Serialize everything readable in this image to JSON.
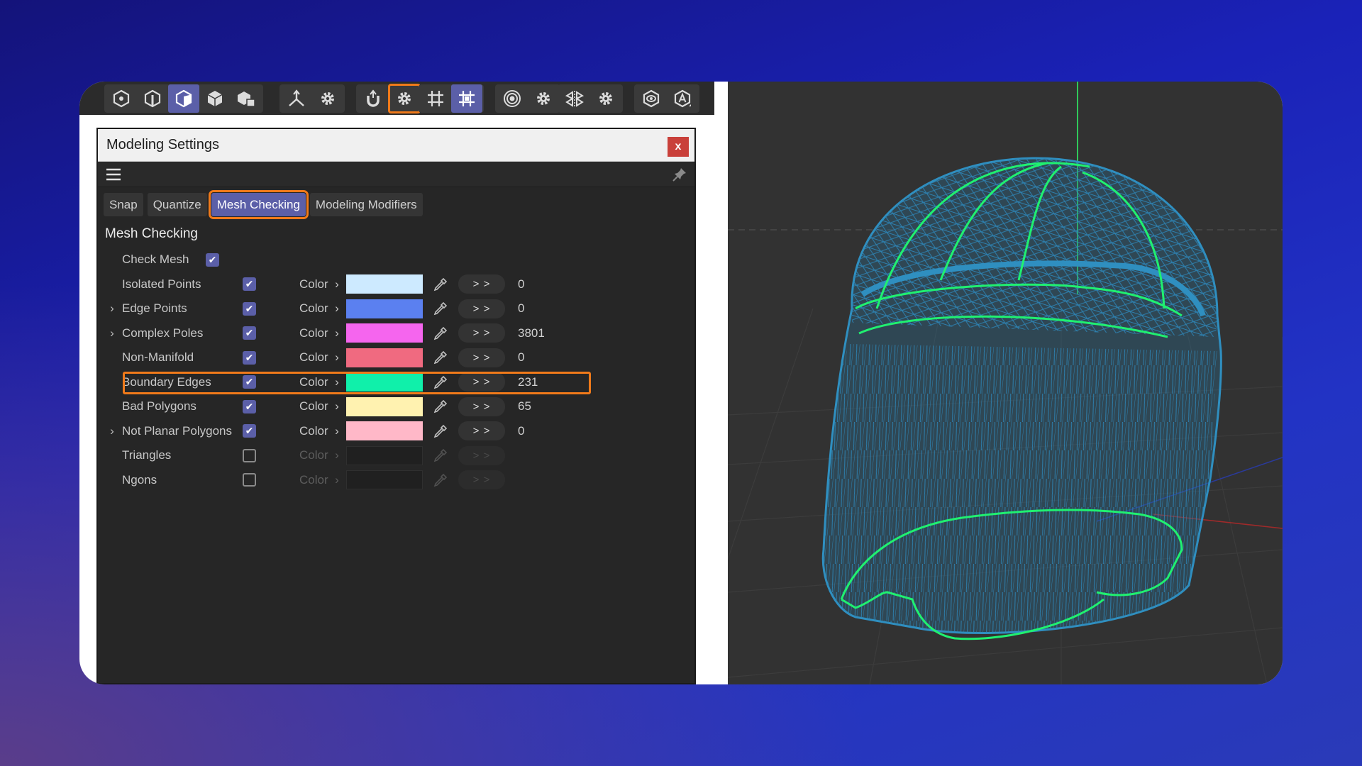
{
  "toolbar": {
    "groups": [
      [
        "point-mode-icon",
        "edge-mode-icon",
        "polygon-mode-icon",
        "model-mode-icon",
        "object-mode-icon"
      ],
      [
        "axis-icon",
        "gear-icon"
      ],
      [
        "magnet-snap-icon",
        "gear-icon"
      ],
      [
        "grid-snap-icon",
        "quantize-icon"
      ],
      [
        "target-icon",
        "gear-icon"
      ],
      [
        "symmetry-icon",
        "gear-icon"
      ],
      [
        "solo-icon",
        "workplane-icon"
      ]
    ]
  },
  "panel": {
    "title": "Modeling Settings",
    "close_label": "x",
    "tabs": [
      "Snap",
      "Quantize",
      "Mesh Checking",
      "Modeling Modifiers"
    ],
    "active_tab": "Mesh Checking",
    "section_title": "Mesh Checking",
    "check_mesh_label": "Check Mesh",
    "check_mesh_checked": true,
    "color_label": "Color",
    "go_label": "> >",
    "rows": [
      {
        "label": "Isolated Points",
        "expandable": false,
        "checked": true,
        "color": "#cdeaff",
        "count": "0"
      },
      {
        "label": "Edge Points",
        "expandable": true,
        "checked": true,
        "color": "#5b80f0",
        "count": "0"
      },
      {
        "label": "Complex Poles",
        "expandable": true,
        "checked": true,
        "color": "#f565ee",
        "count": "3801"
      },
      {
        "label": "Non-Manifold",
        "expandable": false,
        "checked": true,
        "color": "#f06a80",
        "count": "0"
      },
      {
        "label": "Boundary Edges",
        "expandable": false,
        "checked": true,
        "color": "#10f0aa",
        "count": "231",
        "highlighted": true
      },
      {
        "label": "Bad Polygons",
        "expandable": false,
        "checked": true,
        "color": "#fff2b0",
        "count": "65"
      },
      {
        "label": "Not Planar Polygons",
        "expandable": true,
        "checked": true,
        "color": "#ffb8c8",
        "count": "0"
      },
      {
        "label": "Triangles",
        "expandable": false,
        "checked": false,
        "color": "",
        "count": ""
      },
      {
        "label": "Ngons",
        "expandable": false,
        "checked": false,
        "color": "",
        "count": ""
      }
    ]
  },
  "colors": {
    "accent": "#5b5fa8",
    "highlight": "#f07a1a",
    "wireframe": "#2f8fc0",
    "boundary": "#20f070"
  }
}
